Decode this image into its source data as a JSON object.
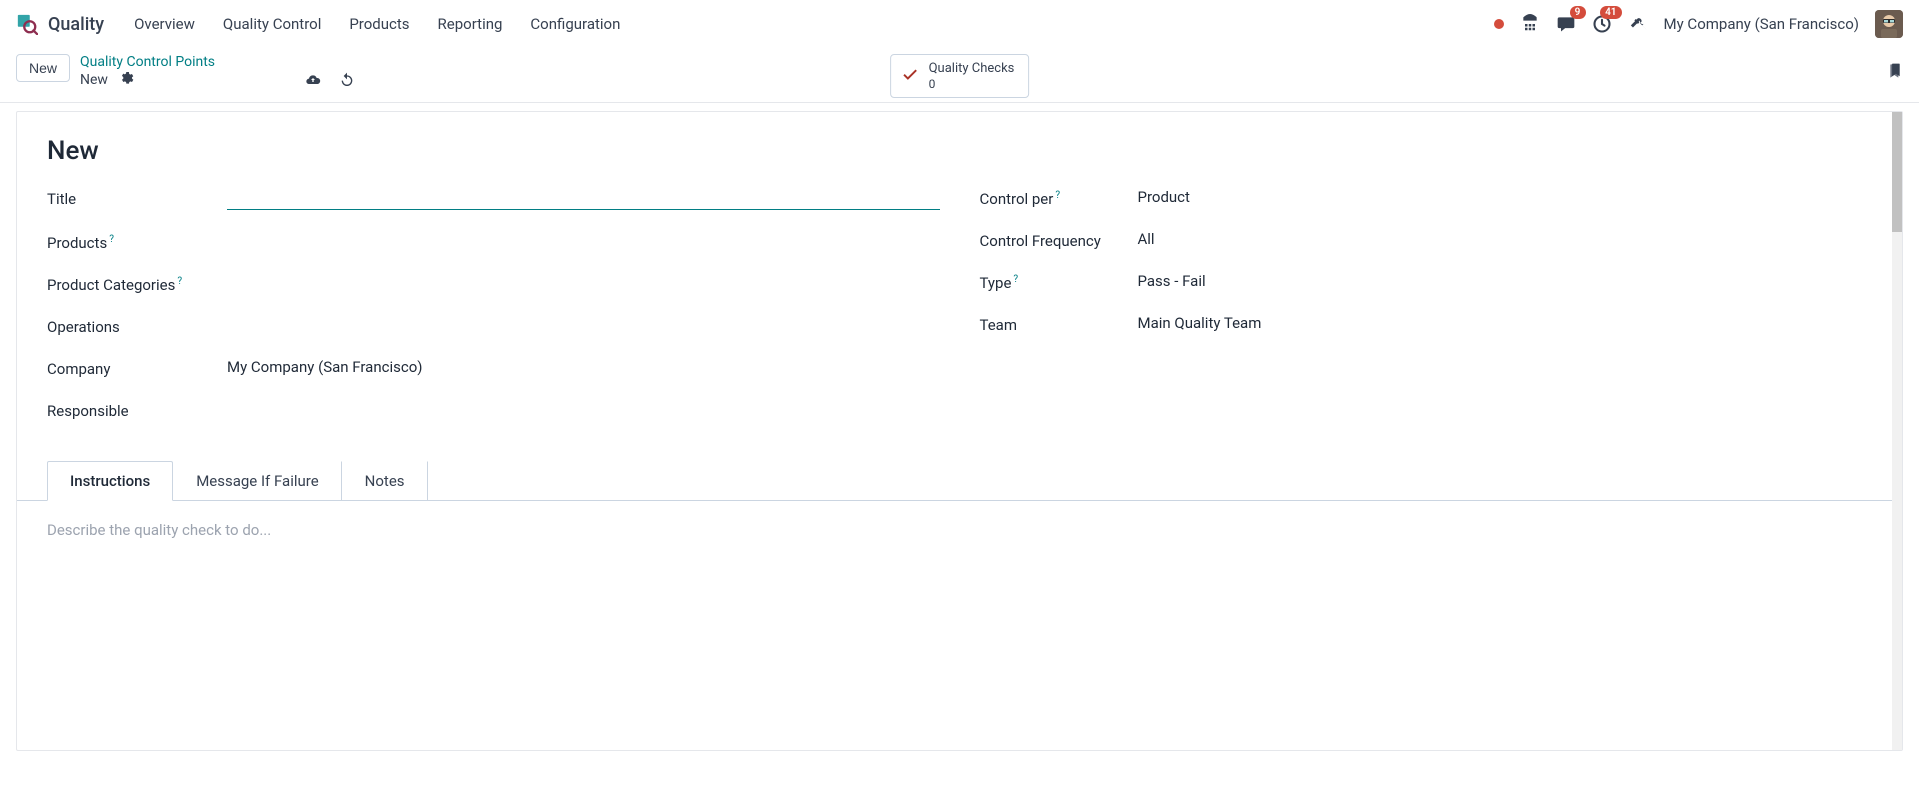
{
  "navbar": {
    "app_name": "Quality",
    "items": [
      "Overview",
      "Quality Control",
      "Products",
      "Reporting",
      "Configuration"
    ],
    "messages_badge": "9",
    "activities_badge": "41",
    "company": "My Company (San Francisco)"
  },
  "controlbar": {
    "new_button": "New",
    "breadcrumb_link": "Quality Control Points",
    "breadcrumb_current": "New",
    "stat": {
      "label": "Quality Checks",
      "count": "0"
    }
  },
  "form": {
    "title_heading": "New",
    "left": {
      "title": {
        "label": "Title",
        "value": ""
      },
      "products": {
        "label": "Products",
        "help": "?"
      },
      "product_categories": {
        "label": "Product Categories",
        "help": "?"
      },
      "operations": {
        "label": "Operations"
      },
      "company": {
        "label": "Company",
        "value": "My Company (San Francisco)"
      },
      "responsible": {
        "label": "Responsible"
      }
    },
    "right": {
      "control_per": {
        "label": "Control per",
        "help": "?",
        "value": "Product"
      },
      "control_frequency": {
        "label": "Control Frequency",
        "value": "All"
      },
      "type": {
        "label": "Type",
        "help": "?",
        "value": "Pass - Fail"
      },
      "team": {
        "label": "Team",
        "value": "Main Quality Team"
      }
    }
  },
  "tabs": {
    "items": [
      "Instructions",
      "Message If Failure",
      "Notes"
    ],
    "instructions_placeholder": "Describe the quality check to do..."
  }
}
